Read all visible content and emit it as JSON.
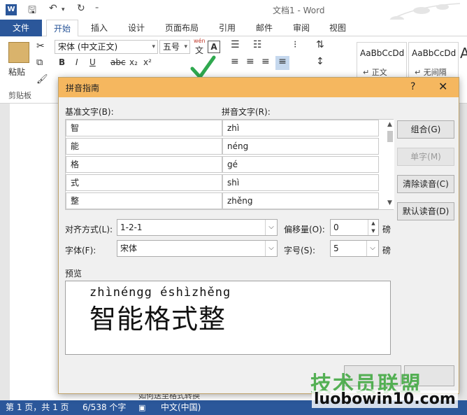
{
  "titlebar": {
    "title": "文档1 - Word"
  },
  "tabs": {
    "file": "文件",
    "items": [
      "开始",
      "插入",
      "设计",
      "页面布局",
      "引用",
      "邮件",
      "审阅",
      "视图"
    ]
  },
  "ribbon": {
    "paste": "粘贴",
    "clipboard_group": "剪贴板",
    "font_name": "宋体 (中文正文)",
    "font_size": "五号",
    "wen_label": "wén",
    "wen_char": "文",
    "bold": "B",
    "italic": "I",
    "underline": "U",
    "strike": "abc",
    "subscript": "x₂",
    "superscript": "x²",
    "style1": "AaBbCcDd",
    "style1_name": "↵ 正文",
    "style2": "AaBbCcDd",
    "style2_name": "↵ 无间隔",
    "style3": "A"
  },
  "dialog": {
    "title": "拼音指南",
    "help": "?",
    "close": "✕",
    "base_label": "基准文字(B):",
    "pinyin_label": "拼音文字(R):",
    "rows": [
      {
        "base": "智",
        "pinyin": "zhì"
      },
      {
        "base": "能",
        "pinyin": "néng"
      },
      {
        "base": "格",
        "pinyin": "gé"
      },
      {
        "base": "式",
        "pinyin": "shì"
      },
      {
        "base": "整",
        "pinyin": "zhěng"
      }
    ],
    "buttons": {
      "combine": "组合(G)",
      "single": "单字(M)",
      "clear": "清除读音(C)",
      "default": "默认读音(D)"
    },
    "align_label": "对齐方式(L):",
    "align_value": "1-2-1",
    "offset_label": "偏移量(O):",
    "offset_value": "0",
    "offset_unit": "磅",
    "font_label": "字体(F):",
    "font_value": "宋体",
    "size_label": "字号(S):",
    "size_value": "5",
    "size_unit": "磅",
    "preview_label": "预览",
    "preview_pinyin": "zhìnéngg éshìzhěng",
    "preview_base": "智能格式整"
  },
  "document": {
    "partial_line": "如何送至格式转换"
  },
  "statusbar": {
    "page": "第 1 页，共 1 页",
    "words": "6/538 个字",
    "lang": "中文(中国)"
  },
  "watermark": {
    "cn": "技术员联盟",
    "url": "luobowin10.com"
  },
  "colors": {
    "accent": "#2b579a",
    "dialog_title": "#f5b75f",
    "watermark_green": "#3aa63a"
  }
}
